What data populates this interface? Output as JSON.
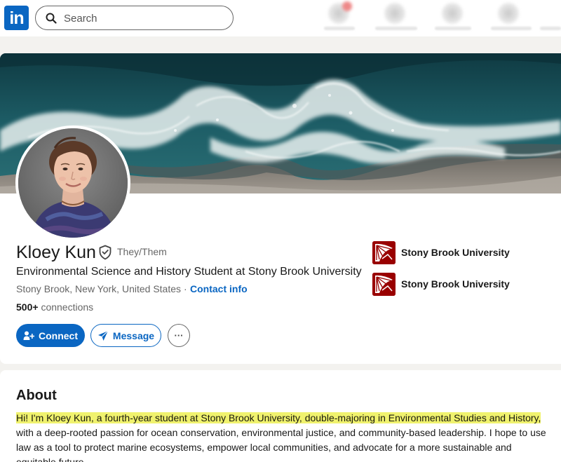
{
  "nav": {
    "logo_text": "in",
    "search": {
      "placeholder": "Search"
    }
  },
  "profile": {
    "name": "Kloey Kun",
    "pronouns": "They/Them",
    "headline": "Environmental Science and History Student at Stony Brook University",
    "location": "Stony Brook, New York, United States",
    "separator": "·",
    "contact_link": "Contact info",
    "connections_count": "500+",
    "connections_label": "connections",
    "buttons": {
      "connect": "Connect",
      "message": "Message",
      "more": "···"
    },
    "education": [
      {
        "name": "Stony Brook University"
      },
      {
        "name": "Stony Brook University"
      }
    ]
  },
  "about": {
    "title": "About",
    "highlighted": "Hi! I'm Kloey Kun, a fourth-year student at Stony Brook University, double-majoring in Environmental Studies and History,",
    "rest": " with a deep-rooted passion for ocean conservation, environmental justice, and community-based leadership. I hope to use law as a tool to protect marine ecosystems, empower local communities, and advocate for a more sustainable and equitable future."
  },
  "colors": {
    "brand": "#0a66c2",
    "university": "#990000",
    "highlight": "#f0f26e"
  }
}
